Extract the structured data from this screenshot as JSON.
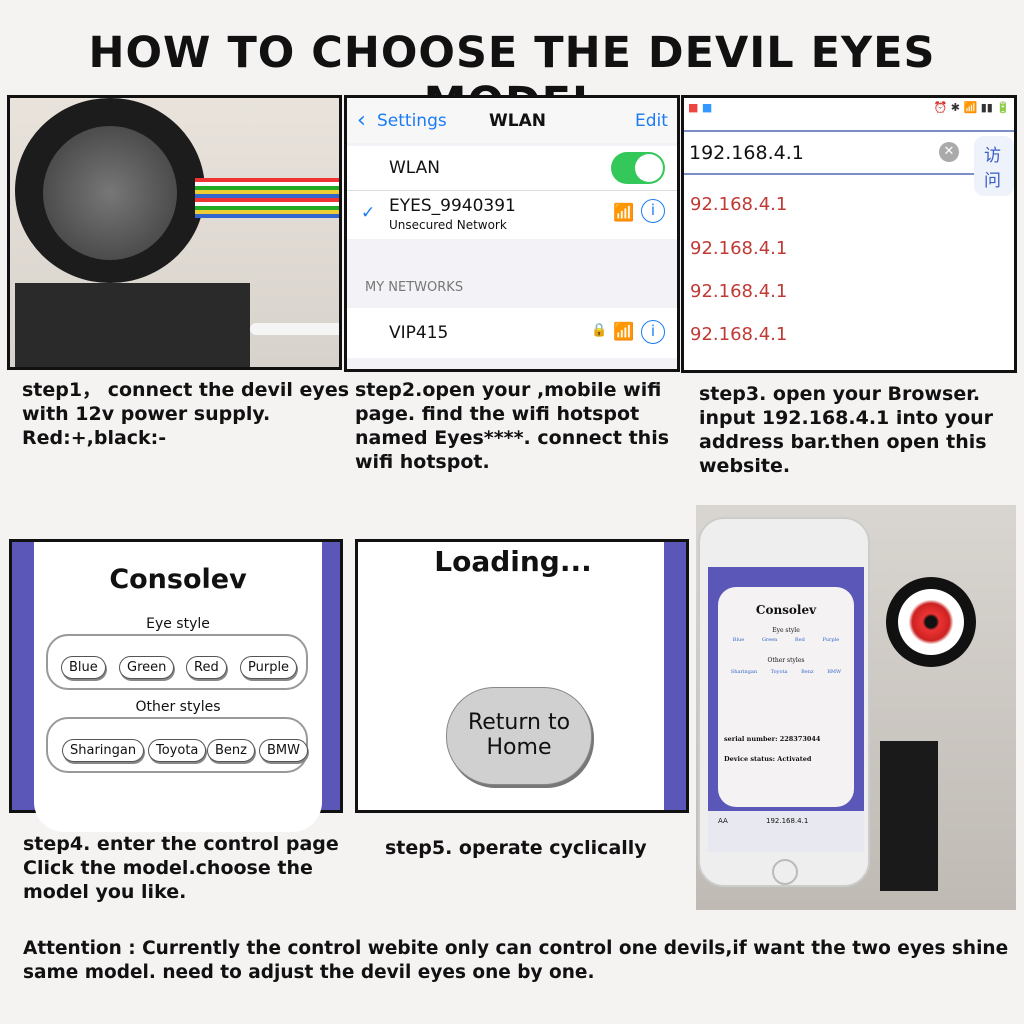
{
  "title": "HOW TO CHOOSE THE DEVIL EYES MODEL",
  "step1": {
    "caption": [
      "step1， connect the devil eyes",
      "with 12v power supply.",
      "Red:+,black:-"
    ]
  },
  "step2": {
    "back_label": "Settings",
    "header": "WLAN",
    "edit": "Edit",
    "wlan_label": "WLAN",
    "wlan_on": true,
    "connected_network": "EYES_9940391",
    "connected_sub": "Unsecured Network",
    "section": "MY NETWORKS",
    "network2": "VIP415",
    "caption": [
      "step2.open your ,mobile wifi",
      "page. find the wifi hotspot",
      "named  Eyes****. connect this",
      "wifi hotspot."
    ]
  },
  "step3": {
    "address": "192.168.4.1",
    "go": "访问",
    "results": [
      "92.168.4.1",
      "92.168.4.1",
      "92.168.4.1",
      "92.168.4.1"
    ],
    "caption": [
      "step3. open your Browser.",
      "input 192.168.4.1 into your",
      "address bar.then open this",
      "website."
    ]
  },
  "step4": {
    "title": "Consolev",
    "eye_style": "Eye style",
    "eye_buttons": [
      "Blue",
      "Green",
      "Red",
      "Purple"
    ],
    "other_styles": "Other styles",
    "other_buttons": [
      "Sharingan",
      "Toyota",
      "Benz",
      "BMW"
    ],
    "caption": [
      "step4. enter the control page",
      "Click the model.choose the",
      "model you like."
    ]
  },
  "step5": {
    "loading": "Loading...",
    "button": [
      "Return to",
      "Home"
    ],
    "caption": "step5. operate cyclically"
  },
  "step6": {
    "title": "Consolev",
    "eye_style": "Eye style",
    "eye_buttons": [
      "Blue",
      "Green",
      "Red",
      "Purple"
    ],
    "other_styles": "Other styles",
    "other_buttons": [
      "Sharingan",
      "Toyota",
      "Benz",
      "BMW"
    ],
    "serial": "serial number: 228373044",
    "status": "Device status: Activated",
    "url": "192.168.4.1",
    "aa": "AA"
  },
  "attention": [
    "Attention : Currently the control webite only can control one devils,if want the two eyes shine",
    "same model. need to adjust the devil eyes one by one."
  ],
  "colors": {
    "accent_purple": "#5b57b8",
    "ios_blue": "#1a7cf5",
    "toggle_green": "#34c759",
    "result_red": "#c03a35"
  }
}
